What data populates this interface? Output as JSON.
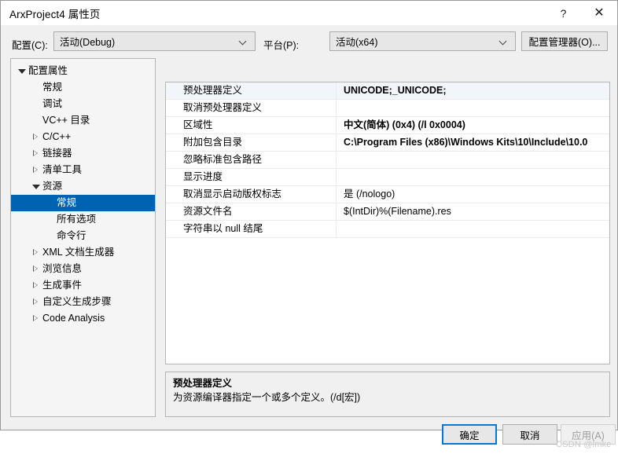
{
  "window": {
    "title": "ArxProject4 属性页",
    "help_icon": "?",
    "close_icon": "✕",
    "help_name": "help",
    "close_name": "close"
  },
  "config_bar": {
    "config_label": "配置(C):",
    "config_value": "活动(Debug)",
    "platform_label": "平台(P):",
    "platform_value": "活动(x64)",
    "config_manager_button": "配置管理器(O)..."
  },
  "tree": {
    "items": [
      {
        "label": "配置属性",
        "indent": 0,
        "twisty": "expanded",
        "selected": false
      },
      {
        "label": "常规",
        "indent": 1,
        "twisty": "none",
        "selected": false
      },
      {
        "label": "调试",
        "indent": 1,
        "twisty": "none",
        "selected": false
      },
      {
        "label": "VC++ 目录",
        "indent": 1,
        "twisty": "none",
        "selected": false
      },
      {
        "label": "C/C++",
        "indent": 1,
        "twisty": "collapsed",
        "selected": false
      },
      {
        "label": "链接器",
        "indent": 1,
        "twisty": "collapsed",
        "selected": false
      },
      {
        "label": "清单工具",
        "indent": 1,
        "twisty": "collapsed",
        "selected": false
      },
      {
        "label": "资源",
        "indent": 1,
        "twisty": "expanded",
        "selected": false
      },
      {
        "label": "常规",
        "indent": 2,
        "twisty": "none",
        "selected": true
      },
      {
        "label": "所有选项",
        "indent": 2,
        "twisty": "none",
        "selected": false
      },
      {
        "label": "命令行",
        "indent": 2,
        "twisty": "none",
        "selected": false
      },
      {
        "label": "XML 文档生成器",
        "indent": 1,
        "twisty": "collapsed",
        "selected": false
      },
      {
        "label": "浏览信息",
        "indent": 1,
        "twisty": "collapsed",
        "selected": false
      },
      {
        "label": "生成事件",
        "indent": 1,
        "twisty": "collapsed",
        "selected": false
      },
      {
        "label": "自定义生成步骤",
        "indent": 1,
        "twisty": "collapsed",
        "selected": false
      },
      {
        "label": "Code Analysis",
        "indent": 1,
        "twisty": "collapsed",
        "selected": false
      }
    ]
  },
  "property_grid": {
    "rows": [
      {
        "name": "预处理器定义",
        "value": "UNICODE;_UNICODE;",
        "bold": true,
        "selected": true
      },
      {
        "name": "取消预处理器定义",
        "value": "",
        "bold": true,
        "selected": false
      },
      {
        "name": "区域性",
        "value": "中文(简体) (0x4) (/l 0x0004)",
        "bold": true,
        "selected": false
      },
      {
        "name": "附加包含目录",
        "value": "C:\\Program Files (x86)\\Windows Kits\\10\\Include\\10.0",
        "bold": true,
        "selected": false
      },
      {
        "name": "忽略标准包含路径",
        "value": "",
        "bold": true,
        "selected": false
      },
      {
        "name": "显示进度",
        "value": "",
        "bold": true,
        "selected": false
      },
      {
        "name": "取消显示启动版权标志",
        "value": "是 (/nologo)",
        "bold": false,
        "selected": false
      },
      {
        "name": "资源文件名",
        "value": "$(IntDir)%(Filename).res",
        "bold": false,
        "selected": false
      },
      {
        "name": "字符串以 null 结尾",
        "value": "",
        "bold": false,
        "selected": false
      }
    ]
  },
  "description": {
    "title": "预处理器定义",
    "text": "为资源编译器指定一个或多个定义。(/d[宏])"
  },
  "footer": {
    "ok_label": "确定",
    "cancel_label": "取消",
    "apply_label": "应用(A)"
  },
  "watermark": "CSDN @lmke",
  "colors": {
    "accent": "#0078d7",
    "tree_selection": "#0063b1",
    "row_selection": "#f2f6fb",
    "dialog_bg": "#f0f0f0"
  }
}
